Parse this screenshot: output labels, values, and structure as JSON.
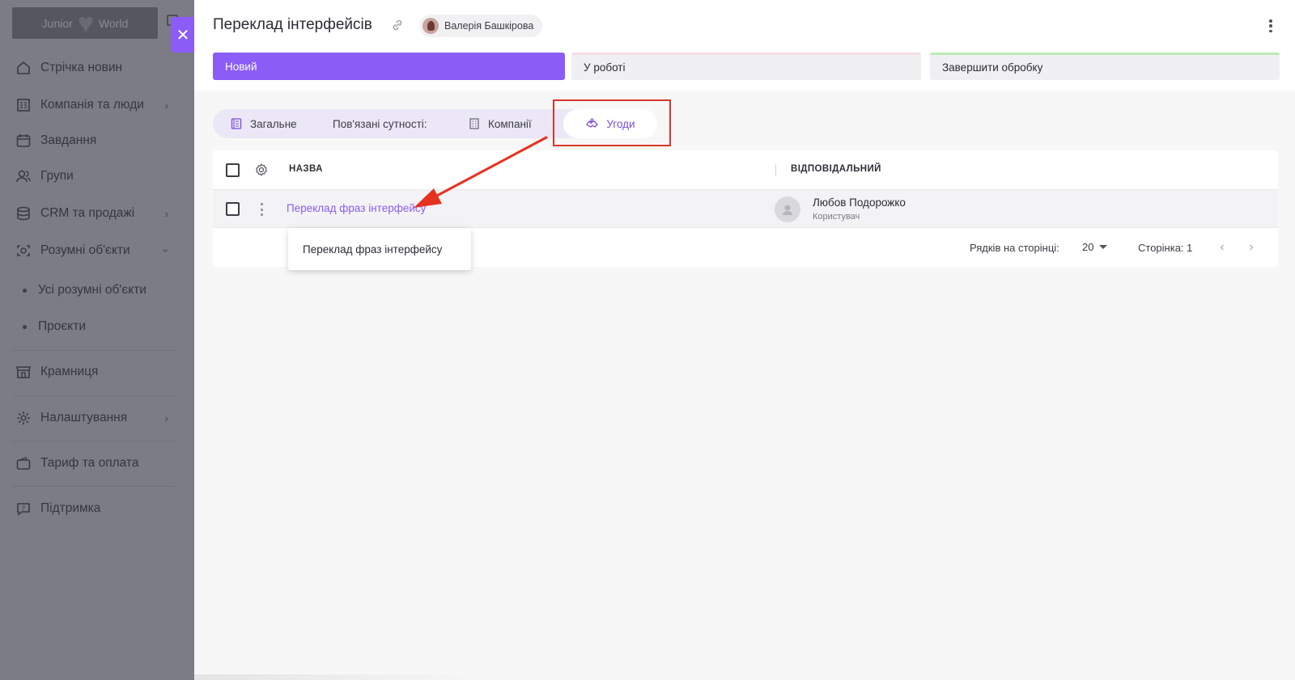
{
  "sidebar": {
    "logo": {
      "left": "Junior",
      "right": "World"
    },
    "items": [
      {
        "label": "Стрічка новин",
        "icon": "home-icon"
      },
      {
        "label": "Компанія та люди",
        "icon": "building-icon"
      },
      {
        "label": "Завдання",
        "icon": "calendar-icon"
      },
      {
        "label": "Групи",
        "icon": "users-icon"
      },
      {
        "label": "CRM та продажі",
        "icon": "database-icon"
      },
      {
        "label": "Розумні об'єкти",
        "icon": "smart-object-icon"
      },
      {
        "label": "Крамниця",
        "icon": "store-icon"
      },
      {
        "label": "Налаштування",
        "icon": "gear-icon"
      },
      {
        "label": "Тариф та оплата",
        "icon": "wallet-icon"
      },
      {
        "label": "Підтримка",
        "icon": "support-icon"
      }
    ],
    "sub_items": [
      {
        "label": "Усі розумні об'єкти"
      },
      {
        "label": "Проєкти"
      }
    ]
  },
  "header": {
    "title": "Переклад інтерфейсів",
    "owner": "Валерія Башкірова"
  },
  "stages": {
    "new": "Новий",
    "in_progress": "У роботі",
    "finish": "Завершити обробку"
  },
  "tabs": {
    "general": "Загальне",
    "related": "Пов'язані сутності:",
    "companies": "Компанії",
    "deals": "Угоди"
  },
  "table": {
    "headers": {
      "name": "НАЗВА",
      "responsible": "ВІДПОВІДАЛЬНИЙ"
    },
    "rows": [
      {
        "name": "Переклад фраз інтерфейсу",
        "responsible_name": "Любов Подорожко",
        "responsible_role": "Користувач"
      }
    ],
    "tooltip": "Переклад фраз інтерфейсу",
    "footer": {
      "rows_label": "Рядків на сторінці:",
      "rows_value": "20",
      "page_label": "Сторінка: 1"
    }
  },
  "colors": {
    "accent": "#8b5cf6",
    "annotation": "#d8362a",
    "in_progress_stripe": "#f6dbe6",
    "finish_stripe": "#b9ecb4"
  }
}
